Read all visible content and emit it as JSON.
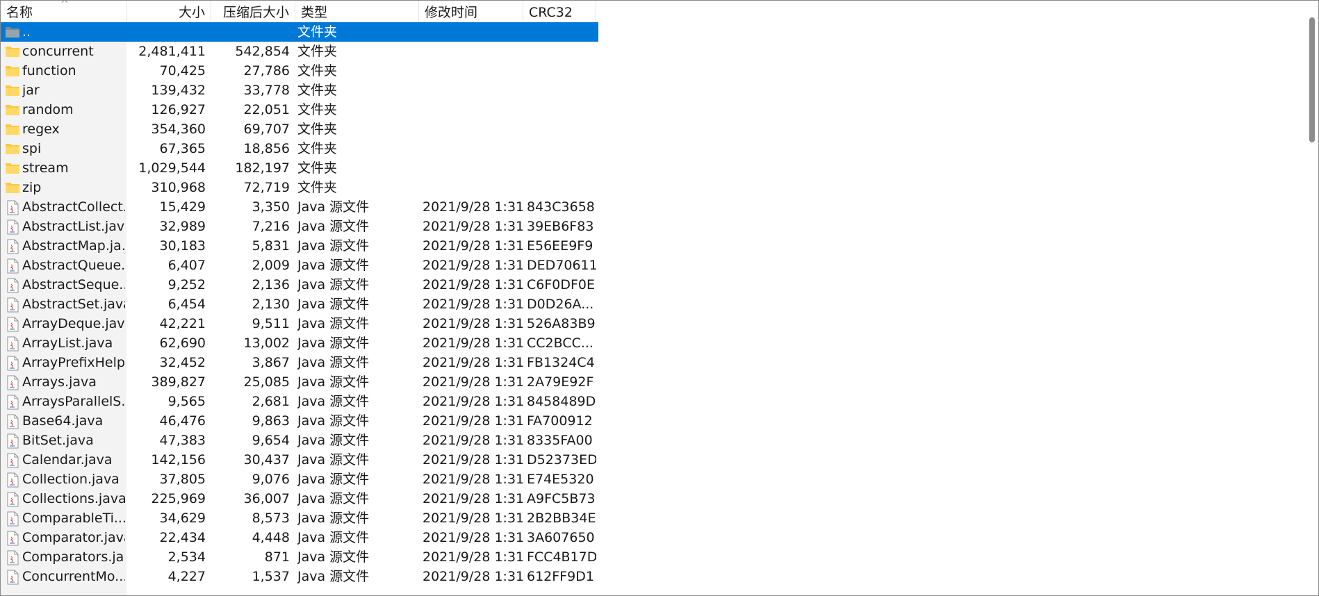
{
  "columns": {
    "name": "名称",
    "size": "大小",
    "packed": "压缩后大小",
    "type": "类型",
    "modified": "修改时间",
    "crc": "CRC32"
  },
  "sort_indicator": "^",
  "colors": {
    "selection": "#0078d7",
    "name_column_bg": "#f3f3f3",
    "folder": "#ffc83d",
    "folder_back": "#7a8a93"
  },
  "rows": [
    {
      "name": "..",
      "size": "",
      "packed": "",
      "type": "文件夹",
      "modified": "",
      "crc": "",
      "icon": "folder-up-icon",
      "selected": true
    },
    {
      "name": "concurrent",
      "size": "2,481,411",
      "packed": "542,854",
      "type": "文件夹",
      "modified": "",
      "crc": "",
      "icon": "folder-icon"
    },
    {
      "name": "function",
      "size": "70,425",
      "packed": "27,786",
      "type": "文件夹",
      "modified": "",
      "crc": "",
      "icon": "folder-icon"
    },
    {
      "name": "jar",
      "size": "139,432",
      "packed": "33,778",
      "type": "文件夹",
      "modified": "",
      "crc": "",
      "icon": "folder-icon"
    },
    {
      "name": "random",
      "size": "126,927",
      "packed": "22,051",
      "type": "文件夹",
      "modified": "",
      "crc": "",
      "icon": "folder-icon"
    },
    {
      "name": "regex",
      "size": "354,360",
      "packed": "69,707",
      "type": "文件夹",
      "modified": "",
      "crc": "",
      "icon": "folder-icon"
    },
    {
      "name": "spi",
      "size": "67,365",
      "packed": "18,856",
      "type": "文件夹",
      "modified": "",
      "crc": "",
      "icon": "folder-icon"
    },
    {
      "name": "stream",
      "size": "1,029,544",
      "packed": "182,197",
      "type": "文件夹",
      "modified": "",
      "crc": "",
      "icon": "folder-icon"
    },
    {
      "name": "zip",
      "size": "310,968",
      "packed": "72,719",
      "type": "文件夹",
      "modified": "",
      "crc": "",
      "icon": "folder-icon"
    },
    {
      "name": "AbstractCollect...",
      "size": "15,429",
      "packed": "3,350",
      "type": "Java 源文件",
      "modified": "2021/9/28 1:31",
      "crc": "843C3658",
      "icon": "java-file-icon"
    },
    {
      "name": "AbstractList.java",
      "size": "32,989",
      "packed": "7,216",
      "type": "Java 源文件",
      "modified": "2021/9/28 1:31",
      "crc": "39EB6F83",
      "icon": "java-file-icon"
    },
    {
      "name": "AbstractMap.ja...",
      "size": "30,183",
      "packed": "5,831",
      "type": "Java 源文件",
      "modified": "2021/9/28 1:31",
      "crc": "E56EE9F9",
      "icon": "java-file-icon"
    },
    {
      "name": "AbstractQueue....",
      "size": "6,407",
      "packed": "2,009",
      "type": "Java 源文件",
      "modified": "2021/9/28 1:31",
      "crc": "DED70611",
      "icon": "java-file-icon"
    },
    {
      "name": "AbstractSeque...",
      "size": "9,252",
      "packed": "2,136",
      "type": "Java 源文件",
      "modified": "2021/9/28 1:31",
      "crc": "C6F0DF0E",
      "icon": "java-file-icon"
    },
    {
      "name": "AbstractSet.java",
      "size": "6,454",
      "packed": "2,130",
      "type": "Java 源文件",
      "modified": "2021/9/28 1:31",
      "crc": "D0D26A...",
      "icon": "java-file-icon"
    },
    {
      "name": "ArrayDeque.java",
      "size": "42,221",
      "packed": "9,511",
      "type": "Java 源文件",
      "modified": "2021/9/28 1:31",
      "crc": "526A83B9",
      "icon": "java-file-icon"
    },
    {
      "name": "ArrayList.java",
      "size": "62,690",
      "packed": "13,002",
      "type": "Java 源文件",
      "modified": "2021/9/28 1:31",
      "crc": "CC2BCC...",
      "icon": "java-file-icon"
    },
    {
      "name": "ArrayPrefixHelp...",
      "size": "32,452",
      "packed": "3,867",
      "type": "Java 源文件",
      "modified": "2021/9/28 1:31",
      "crc": "FB1324C4",
      "icon": "java-file-icon"
    },
    {
      "name": "Arrays.java",
      "size": "389,827",
      "packed": "25,085",
      "type": "Java 源文件",
      "modified": "2021/9/28 1:31",
      "crc": "2A79E92F",
      "icon": "java-file-icon"
    },
    {
      "name": "ArraysParallelS...",
      "size": "9,565",
      "packed": "2,681",
      "type": "Java 源文件",
      "modified": "2021/9/28 1:31",
      "crc": "8458489D",
      "icon": "java-file-icon"
    },
    {
      "name": "Base64.java",
      "size": "46,476",
      "packed": "9,863",
      "type": "Java 源文件",
      "modified": "2021/9/28 1:31",
      "crc": "FA700912",
      "icon": "java-file-icon"
    },
    {
      "name": "BitSet.java",
      "size": "47,383",
      "packed": "9,654",
      "type": "Java 源文件",
      "modified": "2021/9/28 1:31",
      "crc": "8335FA00",
      "icon": "java-file-icon"
    },
    {
      "name": "Calendar.java",
      "size": "142,156",
      "packed": "30,437",
      "type": "Java 源文件",
      "modified": "2021/9/28 1:31",
      "crc": "D52373ED",
      "icon": "java-file-icon"
    },
    {
      "name": "Collection.java",
      "size": "37,805",
      "packed": "9,076",
      "type": "Java 源文件",
      "modified": "2021/9/28 1:31",
      "crc": "E74E5320",
      "icon": "java-file-icon"
    },
    {
      "name": "Collections.java",
      "size": "225,969",
      "packed": "36,007",
      "type": "Java 源文件",
      "modified": "2021/9/28 1:31",
      "crc": "A9FC5B73",
      "icon": "java-file-icon"
    },
    {
      "name": "ComparableTi...",
      "size": "34,629",
      "packed": "8,573",
      "type": "Java 源文件",
      "modified": "2021/9/28 1:31",
      "crc": "2B2BB34E",
      "icon": "java-file-icon"
    },
    {
      "name": "Comparator.java",
      "size": "22,434",
      "packed": "4,448",
      "type": "Java 源文件",
      "modified": "2021/9/28 1:31",
      "crc": "3A607650",
      "icon": "java-file-icon"
    },
    {
      "name": "Comparators.ja...",
      "size": "2,534",
      "packed": "871",
      "type": "Java 源文件",
      "modified": "2021/9/28 1:31",
      "crc": "FCC4B17D",
      "icon": "java-file-icon"
    },
    {
      "name": "ConcurrentMo...",
      "size": "4,227",
      "packed": "1,537",
      "type": "Java 源文件",
      "modified": "2021/9/28 1:31",
      "crc": "612FF9D1",
      "icon": "java-file-icon"
    }
  ]
}
